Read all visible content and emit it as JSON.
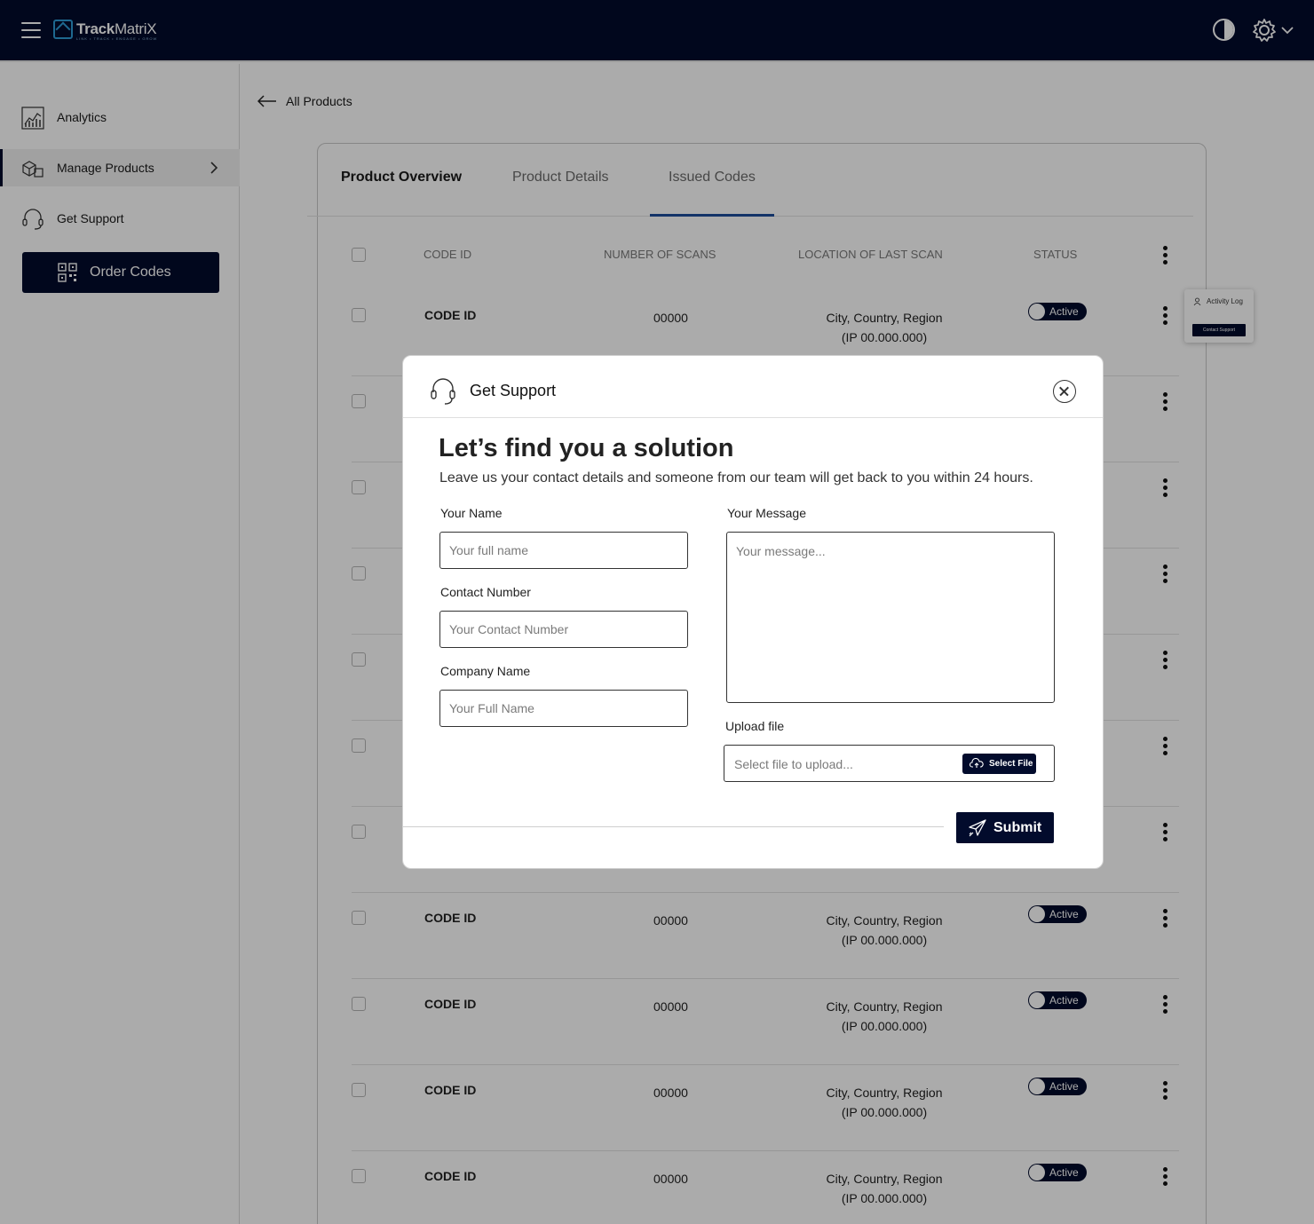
{
  "app": {
    "brand_bold": "Track",
    "brand_light": "MatriX",
    "tagline": "LINK • TRACK • ENGAGE • GROW"
  },
  "sidebar": {
    "items": [
      {
        "label": "Analytics",
        "icon": "analytics-icon"
      },
      {
        "label": "Manage Products",
        "icon": "boxes-icon",
        "active": true
      },
      {
        "label": "Get Support",
        "icon": "headset-icon"
      }
    ],
    "order_button": "Order Codes"
  },
  "breadcrumb": {
    "back_label": "All Products"
  },
  "tabs": [
    {
      "label": "Product Overview"
    },
    {
      "label": "Product Details"
    },
    {
      "label": "Issued Codes",
      "selected": true
    }
  ],
  "table": {
    "headers": [
      "CODE ID",
      "NUMBER OF SCANS",
      "LOCATION OF LAST SCAN",
      "STATUS"
    ],
    "rows": [
      {
        "code": "CODE ID",
        "scans": "00000",
        "loc1": "City, Country, Region",
        "loc2": "(IP 00.000.000)",
        "status": "Active"
      },
      {
        "code": "CODE ID",
        "scans": "00000",
        "loc1": "City, Country, Region",
        "loc2": "(IP 00.000.000)",
        "status": "Active"
      },
      {
        "code": "CODE ID",
        "scans": "00000",
        "loc1": "City, Country, Region",
        "loc2": "(IP 00.000.000)",
        "status": "Active"
      },
      {
        "code": "CODE ID",
        "scans": "00000",
        "loc1": "City, Country, Region",
        "loc2": "(IP 00.000.000)",
        "status": "Active"
      },
      {
        "code": "CODE ID",
        "scans": "00000",
        "loc1": "City, Country, Region",
        "loc2": "(IP 00.000.000)",
        "status": "Active"
      }
    ]
  },
  "row_menu": {
    "activity_log": "Activity Log",
    "contact_support": "Contact Support"
  },
  "modal": {
    "title": "Get Support",
    "headline": "Let’s find you a solution",
    "subline": "Leave us your contact details and someone from our team will get back to you within 24 hours.",
    "name_label": "Your Name",
    "name_placeholder": "Your full name",
    "contact_label": "Contact Number",
    "contact_placeholder": "Your Contact Number",
    "company_label": "Company Name",
    "company_placeholder": "Your Full Name",
    "message_label": "Your Message",
    "message_placeholder": "Your message...",
    "upload_label": "Upload file",
    "upload_placeholder": "Select file to upload...",
    "select_file": "Select File",
    "submit": "Submit"
  },
  "colors": {
    "navy": "#020b2c",
    "tab_underline": "#1d4c9c",
    "logo_accent": "#2e9bd6"
  }
}
